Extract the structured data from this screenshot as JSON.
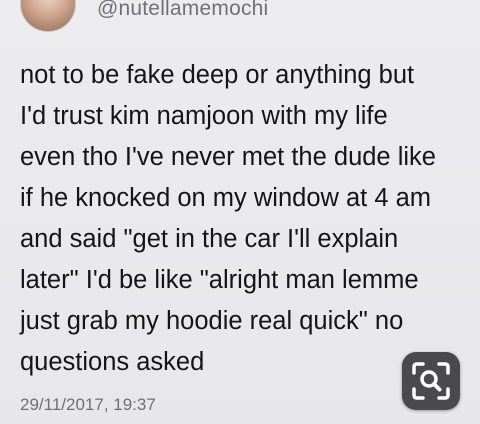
{
  "tweet": {
    "handle": "@nutellamemochi",
    "lines": [
      "not to be fake deep or anything but",
      "I'd trust kim namjoon with my life",
      "even tho I've never met the dude like",
      "if he knocked on my window at 4 am",
      "and said \"get in the car I'll explain",
      "later\" I'd be like \"alright man lemme",
      "just grab my hoodie real quick\" no",
      "questions asked"
    ],
    "timestamp": "29/11/2017, 19:37"
  },
  "overlay": {
    "icon": "visual-search-icon",
    "icon_color": "#ffffff",
    "background_color": "#4a4a4e"
  }
}
